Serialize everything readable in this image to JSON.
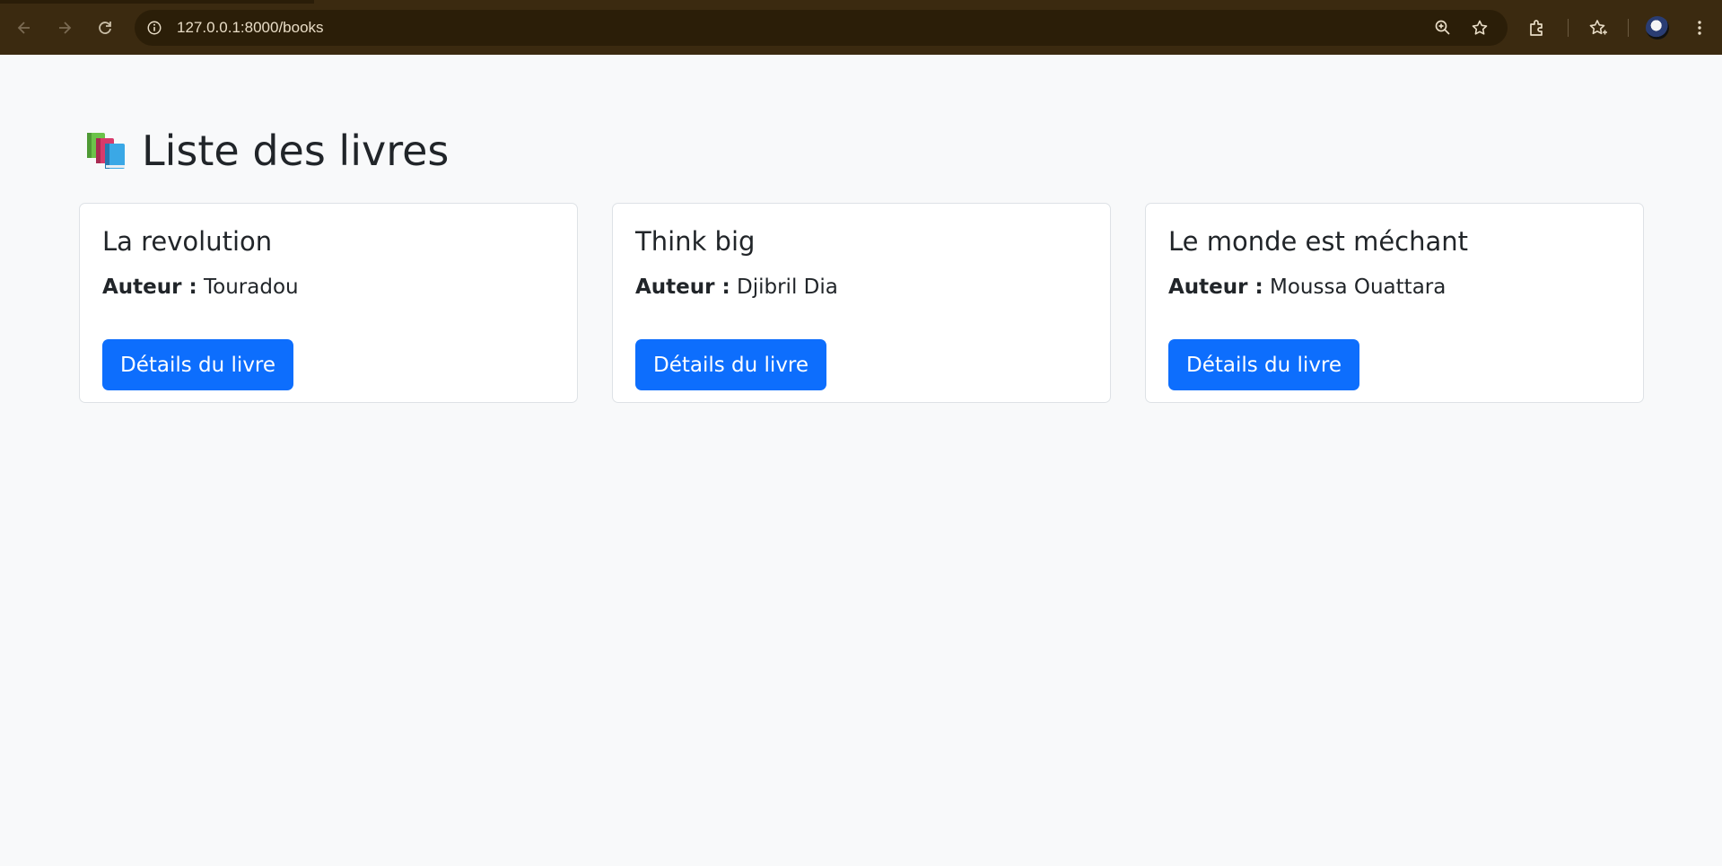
{
  "browser": {
    "url": "127.0.0.1:8000/books",
    "icons": [
      "back-icon",
      "forward-icon",
      "reload-icon",
      "site-info-icon",
      "zoom-icon",
      "star-icon",
      "extensions-icon",
      "bookmarks-icon",
      "avatar",
      "menu-icon"
    ]
  },
  "page": {
    "title": "Liste des livres",
    "title_icon": "books-emoji-icon",
    "colors": {
      "background": "#f8f9fa",
      "primary": "#0d6efd",
      "text": "#212529"
    }
  },
  "books": [
    {
      "title": "La revolution",
      "author_label": "Auteur :",
      "author": "Touradou",
      "button_label": "Détails du livre"
    },
    {
      "title": "Think big",
      "author_label": "Auteur :",
      "author": "Djibril Dia",
      "button_label": "Détails du livre"
    },
    {
      "title": "Le monde est méchant",
      "author_label": "Auteur :",
      "author": "Moussa Ouattara",
      "button_label": "Détails du livre"
    }
  ]
}
